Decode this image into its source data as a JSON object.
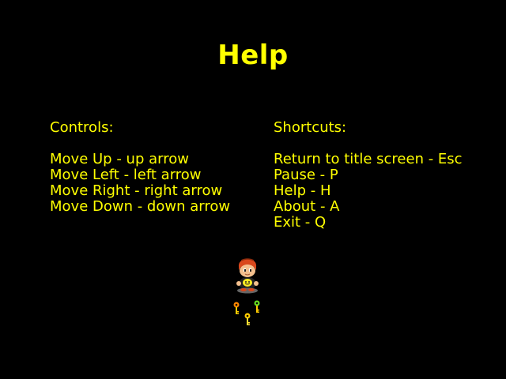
{
  "screen": {
    "title": "Help",
    "text_color": "#ffff00",
    "background": "#000000"
  },
  "controls": {
    "heading": "Controls:",
    "items": [
      "Move Up - up arrow",
      "Move Left - left arrow",
      "Move Right - right arrow",
      "Move Down - down arrow"
    ]
  },
  "shortcuts": {
    "heading": "Shortcuts:",
    "items": [
      "Return to title screen - Esc",
      "Pause - P",
      "Help - H",
      "About - A",
      "Exit - Q"
    ]
  },
  "sprites": {
    "player": "player-character-sprite",
    "keys": [
      {
        "name": "key-icon",
        "color": "#ff8800"
      },
      {
        "name": "key-icon",
        "color": "#66dd22"
      },
      {
        "name": "key-icon",
        "color": "#ffcc00"
      }
    ]
  }
}
